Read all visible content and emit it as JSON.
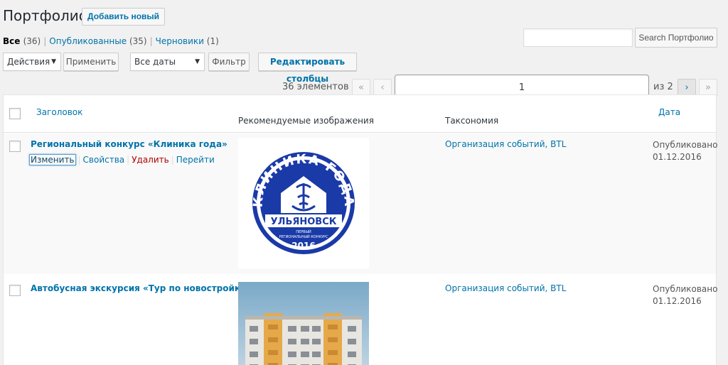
{
  "header": {
    "title": "Портфолио",
    "add_new": "Добавить новый"
  },
  "views": {
    "all": "Все",
    "all_count": "(36)",
    "published": "Опубликованные",
    "published_count": "(35)",
    "drafts": "Черновики",
    "drafts_count": "(1)"
  },
  "search": {
    "button": "Search Портфолио",
    "value": ""
  },
  "toolbar": {
    "bulk_action": "Действия",
    "apply": "Применить",
    "dates": "Все даты",
    "filter": "Фильтр",
    "edit_columns": "Редактировать столбцы"
  },
  "pagination": {
    "items": "36 элементов",
    "first": "«",
    "prev": "‹",
    "current": "1",
    "of": "из 2",
    "next": "›",
    "last": "»"
  },
  "columns": {
    "title": "Заголовок",
    "featured": "Рекомендуемые изображения",
    "taxonomy": "Таксономия",
    "date": "Дата"
  },
  "rows": [
    {
      "title": "Региональный конкурс «Клиника года»",
      "actions": {
        "edit": "Изменить",
        "quick": "Свойства",
        "delete": "Удалить",
        "view": "Перейти"
      },
      "taxonomy": "Организация событий, BTL",
      "status": "Опубликовано",
      "date": "01.12.2016",
      "logo": {
        "top_text": "КЛИНИКА ГОДА",
        "city": "УЛЬЯНОВСК",
        "sub1": "ПЕРВЫЙ",
        "sub2": "РЕГИОНАЛЬНЫЙ КОНКУРС",
        "year": "2016",
        "color": "#1a3aa8"
      }
    },
    {
      "title": "Автобусная экскурсия «Тур по новостройкам»",
      "taxonomy": "Организация событий, BTL",
      "status": "Опубликовано",
      "date": "01.12.2016"
    }
  ]
}
